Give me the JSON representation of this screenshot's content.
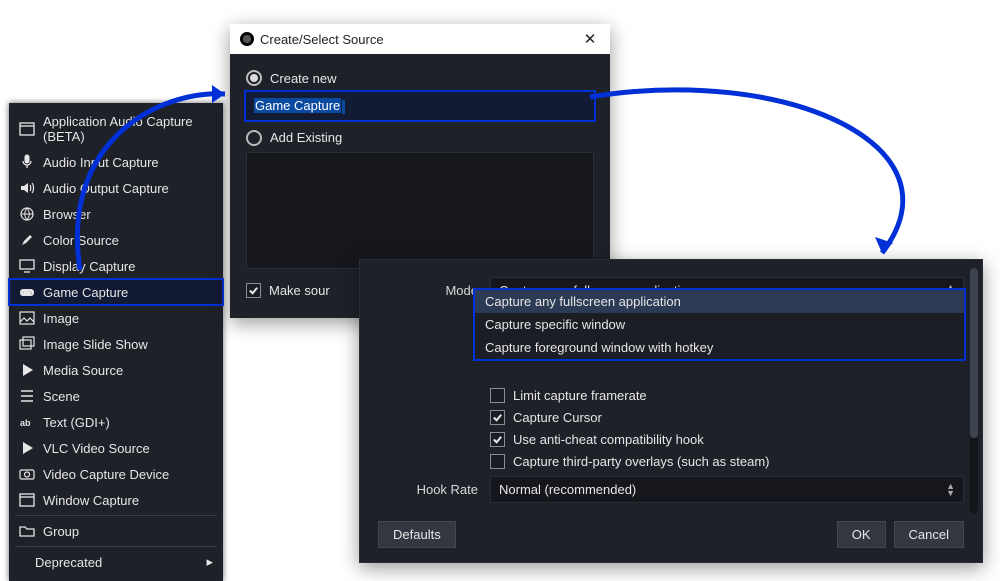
{
  "menu": {
    "items": [
      {
        "label": "Application Audio Capture (BETA)"
      },
      {
        "label": "Audio Input Capture"
      },
      {
        "label": "Audio Output Capture"
      },
      {
        "label": "Browser"
      },
      {
        "label": "Color Source"
      },
      {
        "label": "Display Capture"
      },
      {
        "label": "Game Capture"
      },
      {
        "label": "Image"
      },
      {
        "label": "Image Slide Show"
      },
      {
        "label": "Media Source"
      },
      {
        "label": "Scene"
      },
      {
        "label": "Text (GDI+)"
      },
      {
        "label": "VLC Video Source"
      },
      {
        "label": "Video Capture Device"
      },
      {
        "label": "Window Capture"
      }
    ],
    "group_label": "Group",
    "deprecated_label": "Deprecated",
    "selected_index": 6
  },
  "createDialog": {
    "title": "Create/Select Source",
    "create_new": "Create new",
    "add_existing": "Add Existing",
    "name_value": "Game Capture",
    "make_source_visible": "Make sour"
  },
  "props": {
    "mode_label": "Mode",
    "mode_value": "Capture any fullscreen application",
    "options": [
      "Capture any fullscreen application",
      "Capture specific window",
      "Capture foreground window with hotkey"
    ],
    "limit_framerate": "Limit capture framerate",
    "capture_cursor": "Capture Cursor",
    "anti_cheat": "Use anti-cheat compatibility hook",
    "third_party": "Capture third-party overlays (such as steam)",
    "hook_rate_label": "Hook Rate",
    "hook_rate_value": "Normal (recommended)",
    "defaults": "Defaults",
    "ok": "OK",
    "cancel": "Cancel"
  }
}
